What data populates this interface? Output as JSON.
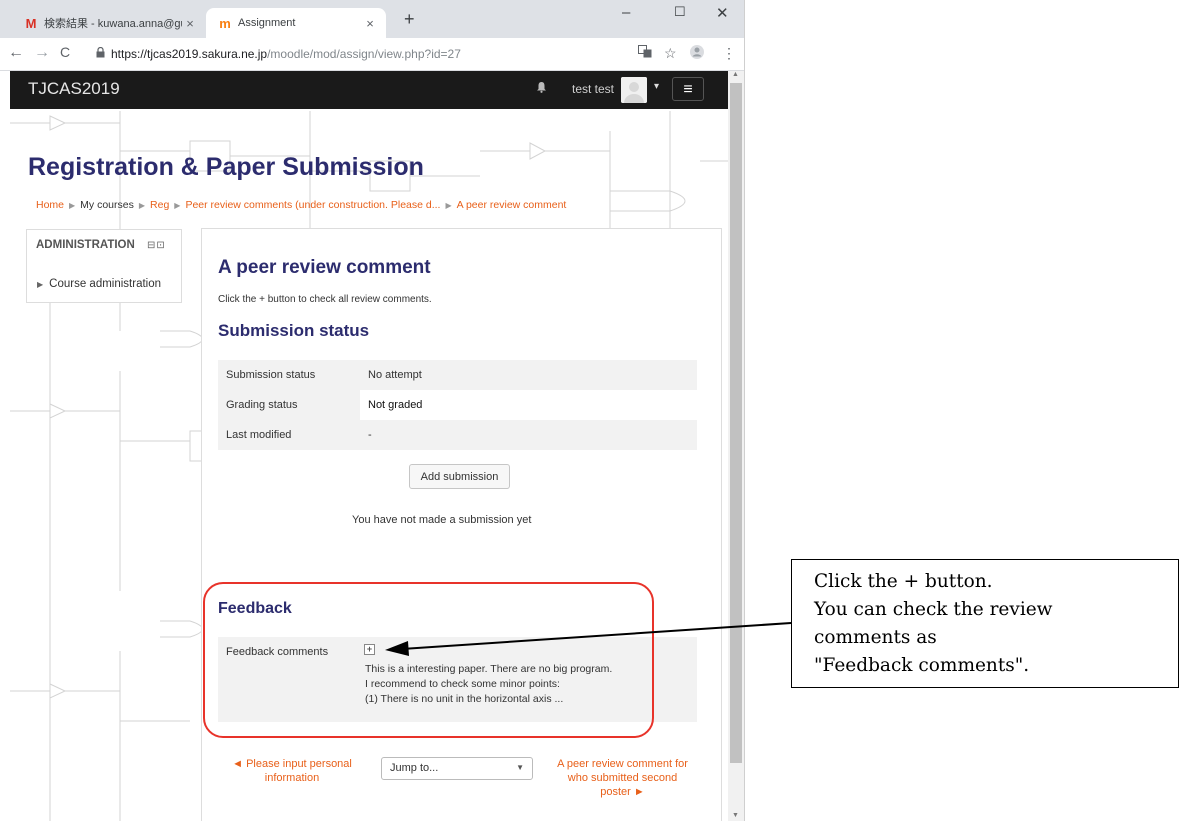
{
  "browser": {
    "tabs": [
      {
        "icon": "M",
        "label": "検索結果 - kuwana.anna@gunma",
        "close": "×"
      },
      {
        "icon": "m",
        "label": "Assignment",
        "close": "×"
      }
    ],
    "new_tab": "+",
    "window_controls": {
      "minimize": "–",
      "maximize": "☐",
      "close": "✕"
    },
    "nav": {
      "back": "←",
      "forward": "→",
      "reload": "C"
    },
    "url_domain": "https://tjcas2019.sakura.ne.jp",
    "url_path": "/moodle/mod/assign/view.php?id=27"
  },
  "navbar": {
    "brand": "TJCAS2019",
    "username": "test test",
    "caret": "▾",
    "menu": "≡"
  },
  "page": {
    "title": "Registration & Paper Submission",
    "breadcrumb": [
      "Home",
      "My courses",
      "Reg",
      "Peer review comments (under construction. Please d...",
      "A peer review comment"
    ]
  },
  "admin_block": {
    "title": "ADMINISTRATION",
    "controls": "⊟⊡",
    "item": "Course administration"
  },
  "main": {
    "heading": "A peer review comment",
    "intro": "Click the + button to check all review comments.",
    "submission_heading": "Submission status",
    "status_rows": [
      {
        "label": "Submission status",
        "value": "No attempt"
      },
      {
        "label": "Grading status",
        "value": "Not graded"
      },
      {
        "label": "Last modified",
        "value": "-"
      }
    ],
    "add_button": "Add submission",
    "no_submission": "You have not made a submission yet",
    "feedback_heading": "Feedback",
    "feedback_label": "Feedback comments",
    "feedback_lines": [
      "This is a interesting paper. There are no big program.",
      "I recommend to check some minor points:",
      "(1) There is no unit in the horizontal axis ..."
    ],
    "prev_link": "◄ Please input personal information",
    "jump_placeholder": "Jump to...",
    "next_link": "A peer review comment for who submitted second poster ►"
  },
  "annotation": {
    "lines": [
      "Click the + button.",
      "You can check the review",
      "comments as",
      "\"Feedback comments\"."
    ],
    "ring_color": "#e8332a"
  },
  "colors": {
    "accent_orange": "#e8601a",
    "heading_navy": "#2c2c6e",
    "navbar_bg": "#1a1a1a"
  }
}
